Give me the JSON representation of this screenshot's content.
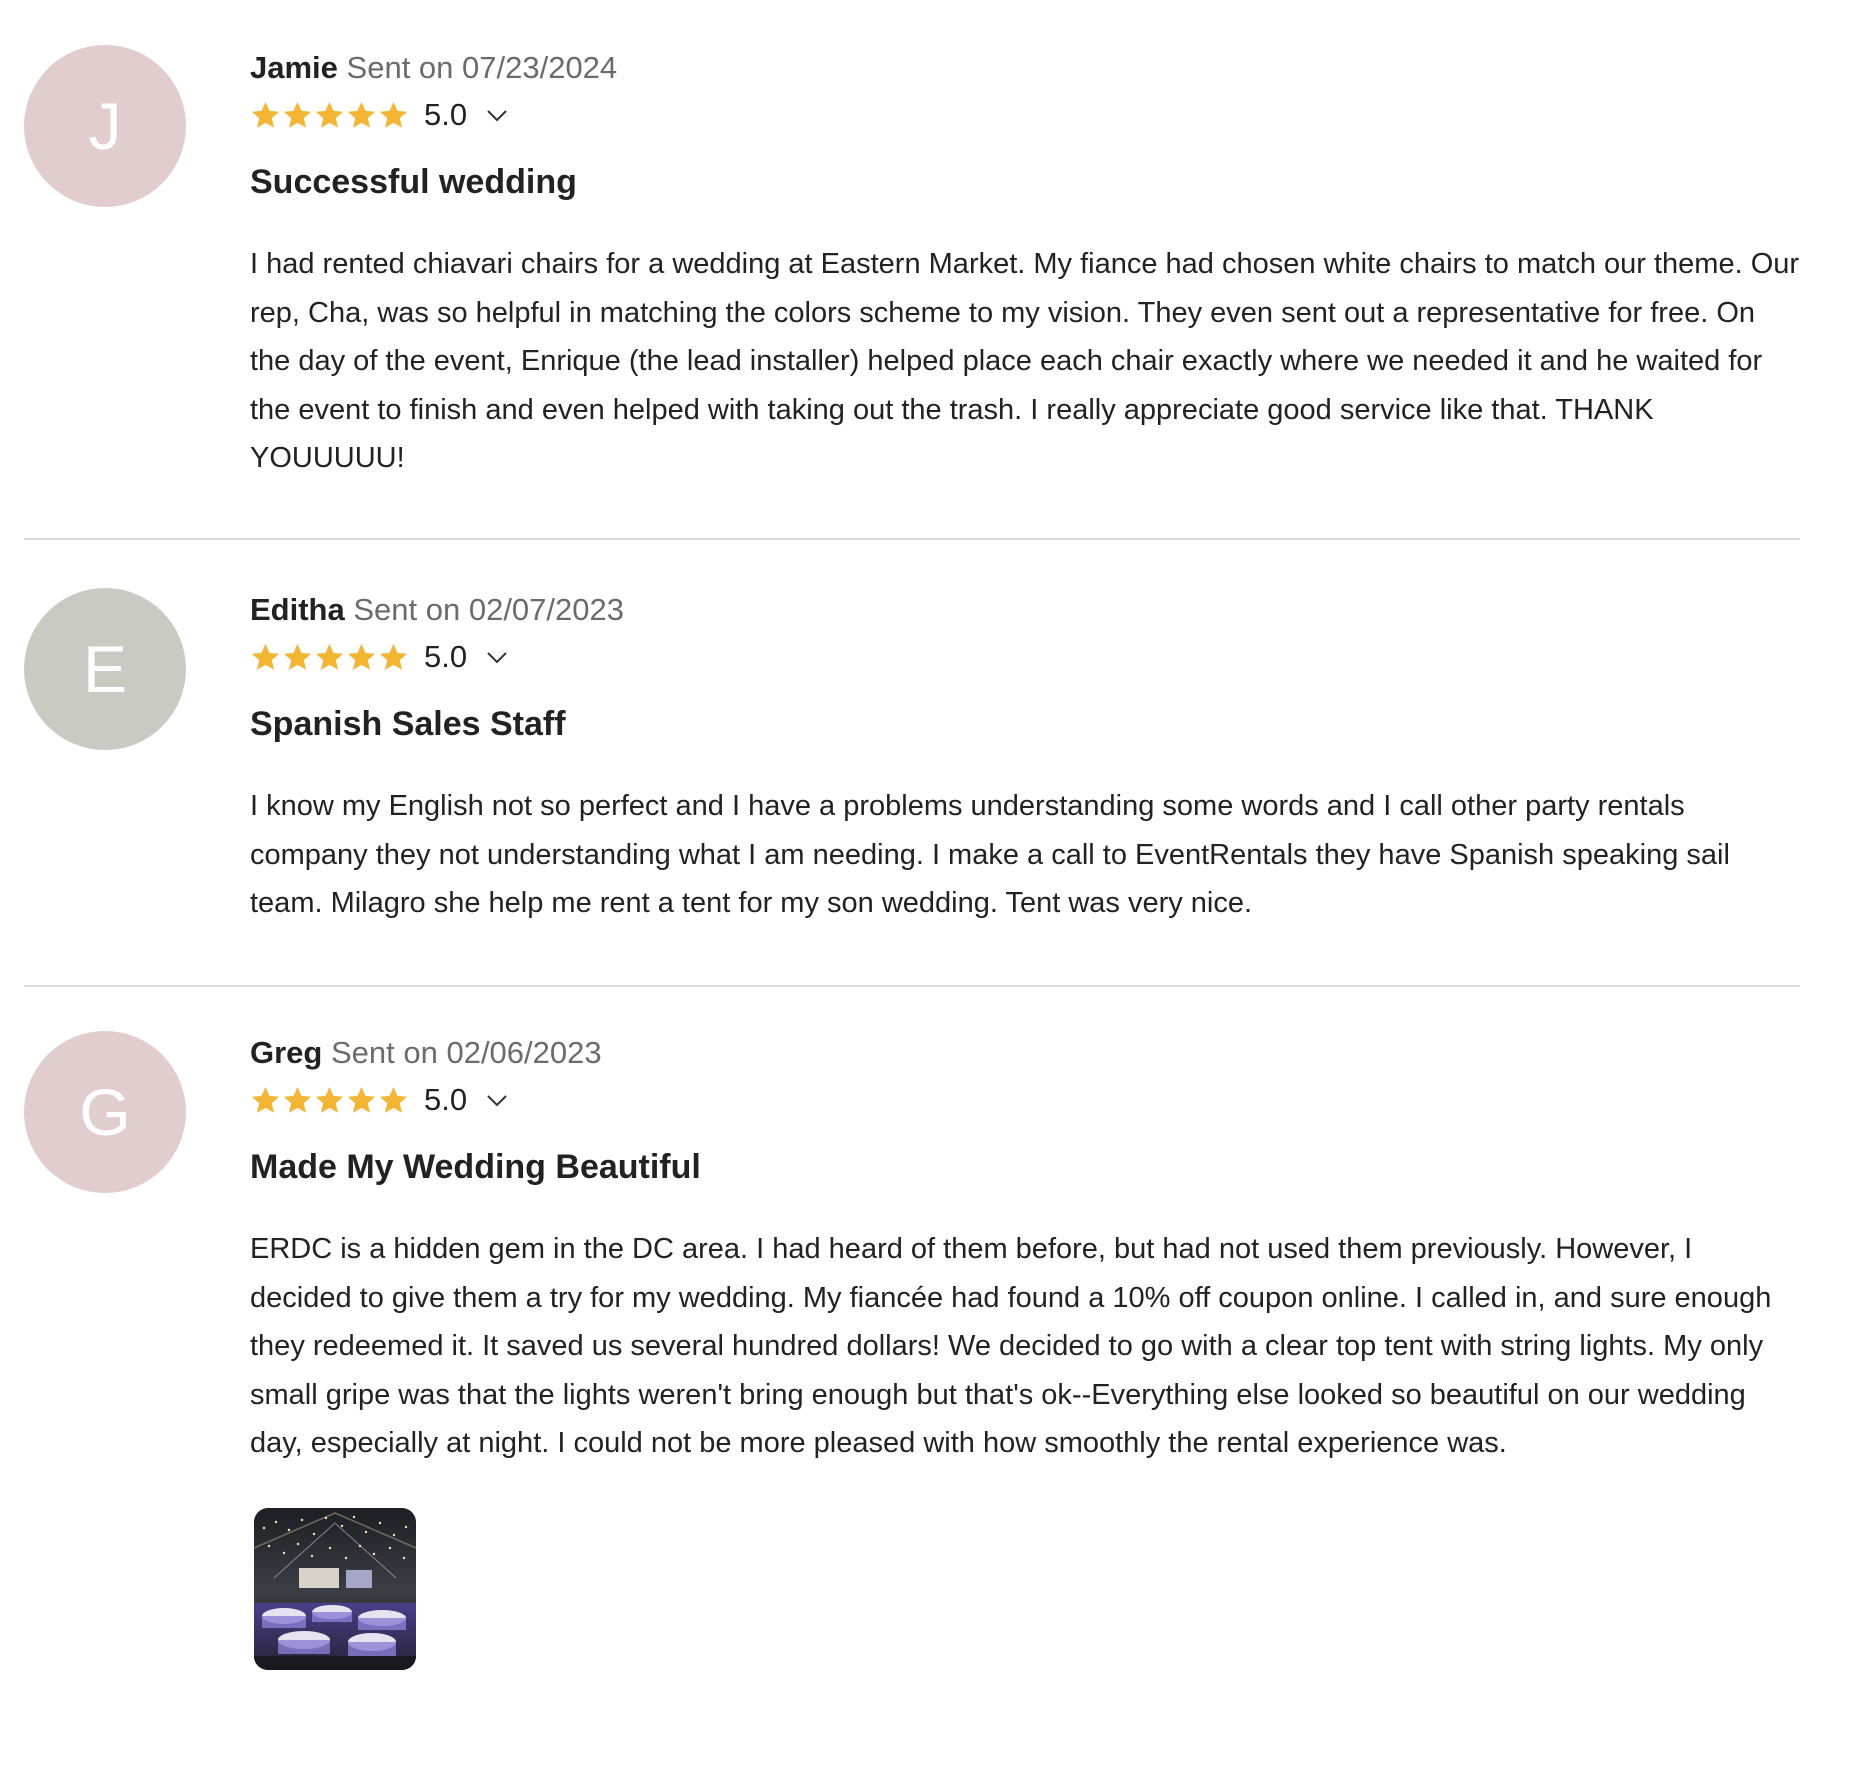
{
  "reviews": [
    {
      "initial": "J",
      "avatar_color": "#e2cdce",
      "author": "Jamie",
      "sent": "Sent on 07/23/2024",
      "rating": 5,
      "rating_label": "5.0",
      "title": "Successful wedding",
      "body": "I had rented chiavari chairs for a wedding at Eastern Market. My fiance had chosen white chairs to match our theme. Our rep, Cha, was so helpful in matching the colors scheme to my vision. They even sent out a representative for free. On the day of the event, Enrique (the lead installer) helped place each chair exactly where we needed it and he waited for the event to finish and even helped with taking out the trash. I really appreciate good service like that. THANK YOUUUUU!"
    },
    {
      "initial": "E",
      "avatar_color": "#c9cac1",
      "author": "Editha",
      "sent": "Sent on 02/07/2023",
      "rating": 5,
      "rating_label": "5.0",
      "title": "Spanish Sales Staff",
      "body": "I know my English not so perfect and I have a problems understanding some words and I call other party rentals company they not understanding what I am needing. I make a call to EventRentals they have Spanish speaking sail team. Milagro she help me rent a tent for my son wedding. Tent was very nice."
    },
    {
      "initial": "G",
      "avatar_color": "#e2cdce",
      "author": "Greg",
      "sent": "Sent on 02/06/2023",
      "rating": 5,
      "rating_label": "5.0",
      "title": "Made My Wedding Beautiful",
      "body": "ERDC is a hidden gem in the DC area. I had heard of them before, but had not used them previously. However, I decided to give them a try for my wedding. My fiancée had found a 10% off coupon online. I called in, and sure enough they redeemed it. It saved us several hundred dollars! We decided to go with a clear top tent with string lights. My only small gripe was that the lights weren't bring enough but that's ok--Everything else looked so beautiful on our wedding day, especially at night. I could not be more pleased with how smoothly the rental experience was."
    }
  ],
  "colors": {
    "star": "#f2b634",
    "author_text": "#222222",
    "date_text": "#6b6b6b",
    "divider": "#dcdcdc"
  },
  "icons": {
    "star": "star-icon",
    "expand": "chevron-down-icon"
  }
}
